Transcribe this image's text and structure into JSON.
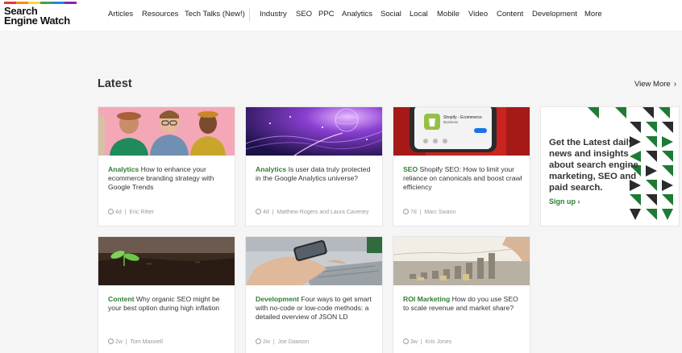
{
  "brand": {
    "line1": "Search",
    "line2": "Engine Watch"
  },
  "nav": {
    "items": [
      "Articles",
      "Resources",
      "Tech Talks (New!)",
      "Industry",
      "SEO",
      "PPC",
      "Analytics",
      "Social",
      "Local",
      "Mobile",
      "Video",
      "Content",
      "Development",
      "More"
    ]
  },
  "section": {
    "title": "Latest",
    "view_more": "View More",
    "chevron": "›"
  },
  "colors": {
    "accent": "#2e7d32",
    "brand_stripe": [
      "#e53935",
      "#fb8c00",
      "#fdd835",
      "#43a047",
      "#1e88e5",
      "#8e24aa"
    ]
  },
  "cards": [
    {
      "category": "Analytics",
      "title": "How to enhance your ecommerce branding strategy with Google Trends",
      "age": "4d",
      "author": "Eric Ritter",
      "image": "people-pink-photo"
    },
    {
      "category": "Analytics",
      "title": "Is user data truly protected in the Google Analytics universe?",
      "age": "4d",
      "author": "Matthew Rogers and Laura Caveney",
      "image": "digital-globe-photo"
    },
    {
      "category": "SEO",
      "title": "Shopify SEO: How to limit your reliance on canonicals and boost crawl efficiency",
      "age": "7d",
      "author": "Marc Swann",
      "image": "shopify-phone-photo"
    },
    {
      "category": "Content",
      "title": "Why organic SEO might be your best option during high inflation",
      "age": "2w",
      "author": "Tom Maxwell",
      "image": "seedling-soil-photo"
    },
    {
      "category": "Development",
      "title": "Four ways to get smart with no-code or low-code methods: a detailed overview of JSON LD",
      "age": "2w",
      "author": "Joe Dawson",
      "image": "laptop-phone-photo"
    },
    {
      "category": "ROI Marketing",
      "title": "How do you use SEO to scale revenue and market share?",
      "age": "3w",
      "author": "Kris Jones",
      "image": "coins-chart-photo"
    }
  ],
  "promo": {
    "text": "Get the Latest daily news and insights about search engine marketing, SEO and paid search.",
    "link": "Sign up",
    "chevron": "›"
  },
  "phone": {
    "app_title": "Shopify - Ecommerce",
    "app_sub": "Business"
  }
}
